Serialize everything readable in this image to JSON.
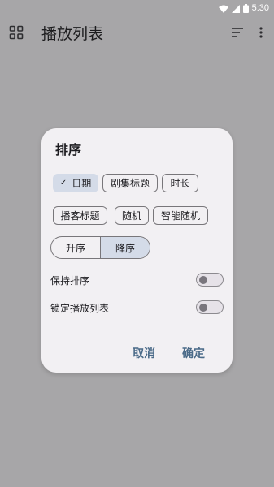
{
  "status_bar": {
    "time": "5:30"
  },
  "app_bar": {
    "title": "播放列表",
    "icons": [
      "grid-icon",
      "sort-icon",
      "more-vert-icon"
    ]
  },
  "dialog": {
    "title": "排序",
    "sort_by_options": [
      {
        "label": "日期",
        "selected": true
      },
      {
        "label": "剧集标题",
        "selected": false
      },
      {
        "label": "时长",
        "selected": false
      },
      {
        "label": "播客标题",
        "selected": false
      },
      {
        "label": "随机",
        "selected": false
      },
      {
        "label": "智能随机",
        "selected": false
      }
    ],
    "order": {
      "ascending": "升序",
      "descending": "降序",
      "selected": "降序"
    },
    "switches": [
      {
        "label": "保持排序",
        "on": false
      },
      {
        "label": "锁定播放列表",
        "on": false
      }
    ],
    "cancel_label": "取消",
    "confirm_label": "确定"
  },
  "colors": {
    "scrim": "#a7a6a8",
    "dialog_bg": "#f2f0f3",
    "selected_bg": "#d4dbe8",
    "accent": "#4a6a88"
  }
}
